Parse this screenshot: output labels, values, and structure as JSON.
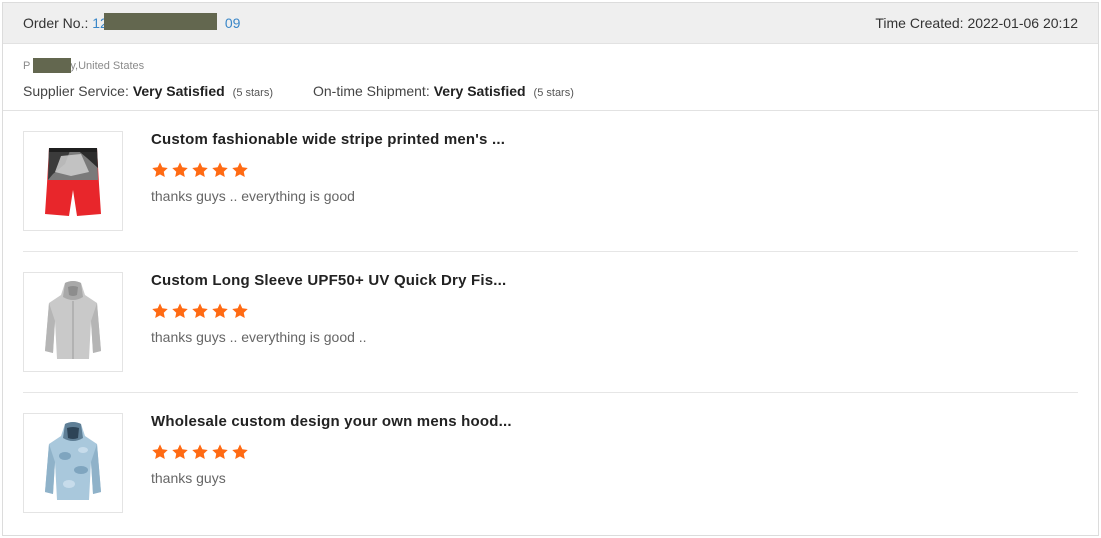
{
  "order": {
    "label": "Order No.:",
    "number_prefix": "12",
    "number_suffix": "09",
    "time_label": "Time Created:",
    "time_value": "2022-01-06 20:12"
  },
  "buyer": {
    "location_prefix": "P",
    "location_suffix": "y,United States"
  },
  "ratings": {
    "supplier_label": "Supplier Service:",
    "supplier_value": "Very Satisfied",
    "supplier_stars": "(5 stars)",
    "shipment_label": "On-time Shipment:",
    "shipment_value": "Very Satisfied",
    "shipment_stars": "(5 stars)"
  },
  "colors": {
    "star": "#ff6a13",
    "link": "#3a87c8",
    "redaction": "#63674f"
  },
  "items": [
    {
      "title": "Custom fashionable wide stripe printed men's ...",
      "rating": 5,
      "review": "thanks guys .. everything is good",
      "thumb_icon": "board-shorts-icon"
    },
    {
      "title": "Custom Long Sleeve UPF50+ UV Quick Dry Fis...",
      "rating": 5,
      "review": "thanks guys .. everything is good ..",
      "thumb_icon": "grey-hoodie-icon"
    },
    {
      "title": "Wholesale custom design your own mens hood...",
      "rating": 5,
      "review": "thanks guys",
      "thumb_icon": "camo-hoodie-icon"
    }
  ]
}
